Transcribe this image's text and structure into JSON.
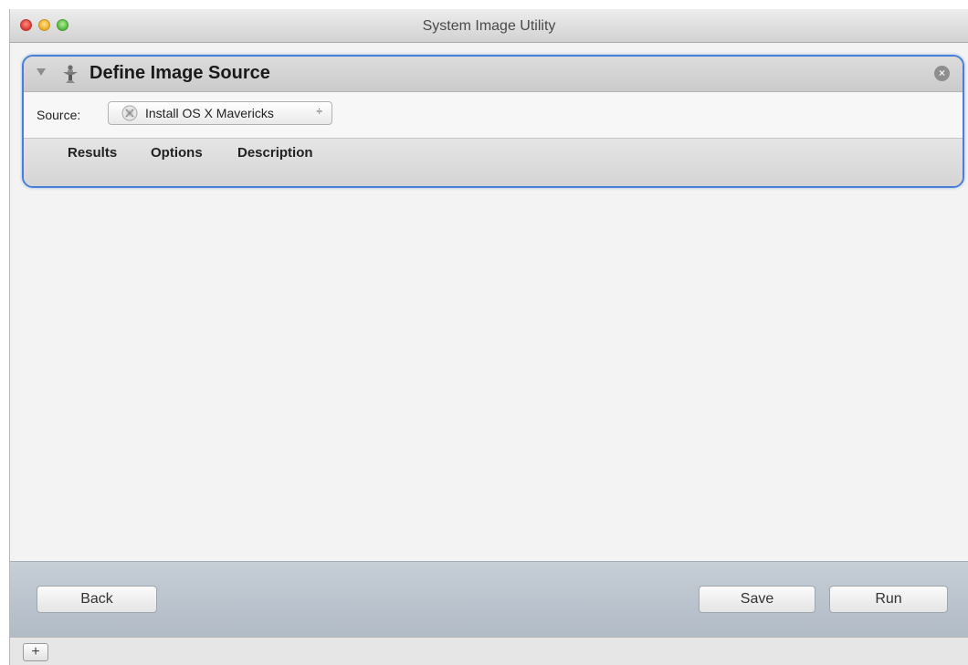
{
  "window": {
    "title": "System Image Utility"
  },
  "action": {
    "title": "Define Image Source",
    "source_label": "Source:",
    "source_value": "Install OS X Mavericks",
    "popup_arrows": "÷",
    "tabs": [
      {
        "label": "Results"
      },
      {
        "label": "Options"
      },
      {
        "label": "Description"
      }
    ],
    "close_glyph": "×"
  },
  "buttons": {
    "back": "Back",
    "save": "Save",
    "run": "Run",
    "add": "+"
  },
  "icons": {
    "action": "automator-robot-icon",
    "source": "os-x-installer-icon"
  },
  "colors": {
    "selection_border": "#4a7fd6",
    "bottom_bar": "#b9c2cc"
  }
}
